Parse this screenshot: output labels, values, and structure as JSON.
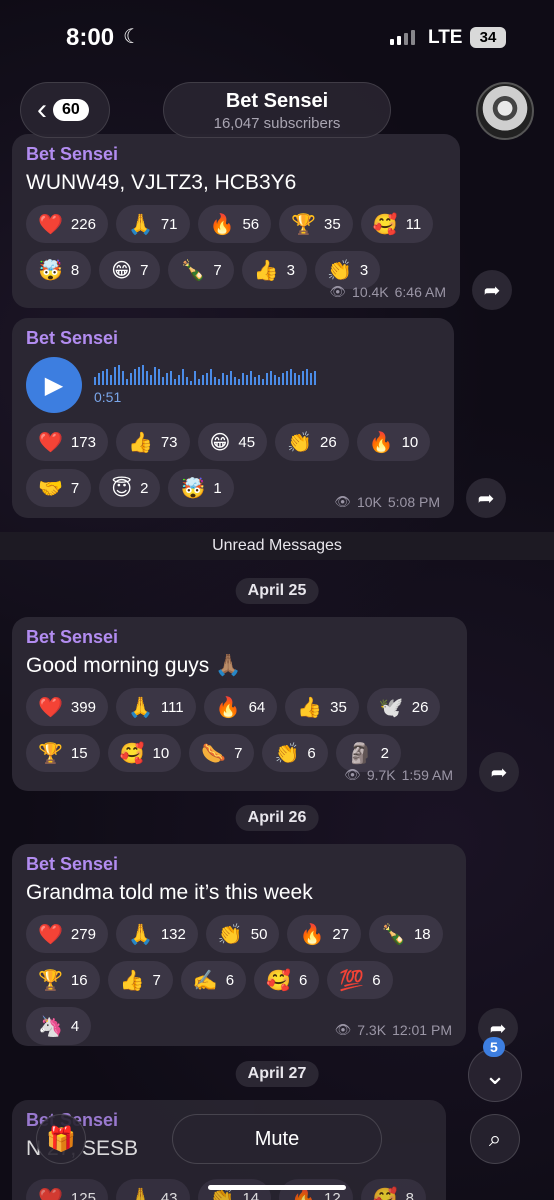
{
  "status": {
    "time": "8:00",
    "network": "LTE",
    "battery": "34"
  },
  "header": {
    "back_count": "60",
    "title": "Bet Sensei",
    "subscribers": "16,047 subscribers"
  },
  "messages": [
    {
      "sender": "Bet Sensei",
      "text": "WUNW49, VJLTZ3, HCB3Y6",
      "reactions": [
        {
          "emoji": "❤️",
          "count": "226"
        },
        {
          "emoji": "🙏",
          "count": "71"
        },
        {
          "emoji": "🔥",
          "count": "56"
        },
        {
          "emoji": "🏆",
          "count": "35"
        },
        {
          "emoji": "🥰",
          "count": "11"
        },
        {
          "emoji": "🤯",
          "count": "8"
        },
        {
          "emoji": "😁",
          "count": "7"
        },
        {
          "emoji": "🍾",
          "count": "7"
        },
        {
          "emoji": "👍",
          "count": "3"
        },
        {
          "emoji": "👏",
          "count": "3"
        }
      ],
      "views": "10.4K",
      "time": "6:46 AM"
    },
    {
      "sender": "Bet Sensei",
      "audio_duration": "0:51",
      "reactions": [
        {
          "emoji": "❤️",
          "count": "173"
        },
        {
          "emoji": "👍",
          "count": "73"
        },
        {
          "emoji": "😁",
          "count": "45"
        },
        {
          "emoji": "👏",
          "count": "26"
        },
        {
          "emoji": "🔥",
          "count": "10"
        },
        {
          "emoji": "🤝",
          "count": "7"
        },
        {
          "emoji": "😇",
          "count": "2"
        },
        {
          "emoji": "🤯",
          "count": "1"
        }
      ],
      "views": "10K",
      "time": "5:08 PM"
    },
    {
      "sender": "Bet Sensei",
      "text": "Good morning guys 🙏🏽",
      "reactions": [
        {
          "emoji": "❤️",
          "count": "399"
        },
        {
          "emoji": "🙏",
          "count": "111"
        },
        {
          "emoji": "🔥",
          "count": "64"
        },
        {
          "emoji": "👍",
          "count": "35"
        },
        {
          "emoji": "🕊️",
          "count": "26"
        },
        {
          "emoji": "🏆",
          "count": "15"
        },
        {
          "emoji": "🥰",
          "count": "10"
        },
        {
          "emoji": "🌭",
          "count": "7"
        },
        {
          "emoji": "👏",
          "count": "6"
        },
        {
          "emoji": "🗿",
          "count": "2"
        }
      ],
      "views": "9.7K",
      "time": "1:59 AM"
    },
    {
      "sender": "Bet Sensei",
      "text": "Grandma told me it’s this week",
      "reactions": [
        {
          "emoji": "❤️",
          "count": "279"
        },
        {
          "emoji": "🙏",
          "count": "132"
        },
        {
          "emoji": "👏",
          "count": "50"
        },
        {
          "emoji": "🔥",
          "count": "27"
        },
        {
          "emoji": "🍾",
          "count": "18"
        },
        {
          "emoji": "🏆",
          "count": "16"
        },
        {
          "emoji": "👍",
          "count": "7"
        },
        {
          "emoji": "✍️",
          "count": "6"
        },
        {
          "emoji": "🥰",
          "count": "6"
        },
        {
          "emoji": "💯",
          "count": "6"
        },
        {
          "emoji": "🦄",
          "count": "4"
        }
      ],
      "views": "7.3K",
      "time": "12:01 PM"
    }
  ],
  "partial_message": {
    "sender": "Bet Sensei",
    "text": "N 27, SESB",
    "reactions": [
      {
        "emoji": "❤️",
        "count": "125"
      },
      {
        "emoji": "🙏",
        "count": "43"
      },
      {
        "emoji": "👏",
        "count": "14"
      },
      {
        "emoji": "🔥",
        "count": "12"
      },
      {
        "emoji": "🥰",
        "count": "8"
      }
    ]
  },
  "separators": {
    "unread": "Unread Messages",
    "date1": "April 25",
    "date2": "April 26",
    "date3": "April 27"
  },
  "bottom": {
    "mute_label": "Mute",
    "unread_badge": "5"
  },
  "icons": {
    "back": "chevron-left-icon",
    "gift": "gift-icon",
    "search": "search-icon",
    "share": "share-icon",
    "eye": "eye-icon",
    "play": "play-icon",
    "scroll": "chevron-down-icon"
  },
  "colors": {
    "accent": "#b28cf0",
    "play": "#3d7ee0",
    "bubble": "#2b2733",
    "chip": "#3b3645"
  }
}
